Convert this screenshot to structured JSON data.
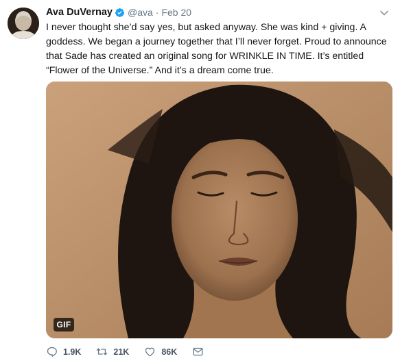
{
  "tweet": {
    "author": {
      "name": "Ava DuVernay",
      "handle": "@ava",
      "verified": true,
      "avatar_icon": "avatar-photo"
    },
    "separator": "·",
    "date": "Feb 20",
    "text": "I never thought she’d say yes, but asked anyway. She was kind + giving. A goddess. We began a journey together that I’ll never forget. Proud to announce that Sade has created an original song for WRINKLE IN TIME. It’s entitled “Flower of the Universe.” And it’s a dream come true.",
    "media": {
      "type": "gif",
      "badge": "GIF"
    },
    "actions": {
      "reply": {
        "icon": "reply-icon",
        "count": "1.9K"
      },
      "retweet": {
        "icon": "retweet-icon",
        "count": "21K"
      },
      "like": {
        "icon": "heart-icon",
        "count": "86K"
      },
      "message": {
        "icon": "direct-message-icon"
      }
    }
  },
  "colors": {
    "text": "#14171a",
    "secondary": "#657786",
    "verified": "#1da1f2",
    "icon": "#657786"
  }
}
